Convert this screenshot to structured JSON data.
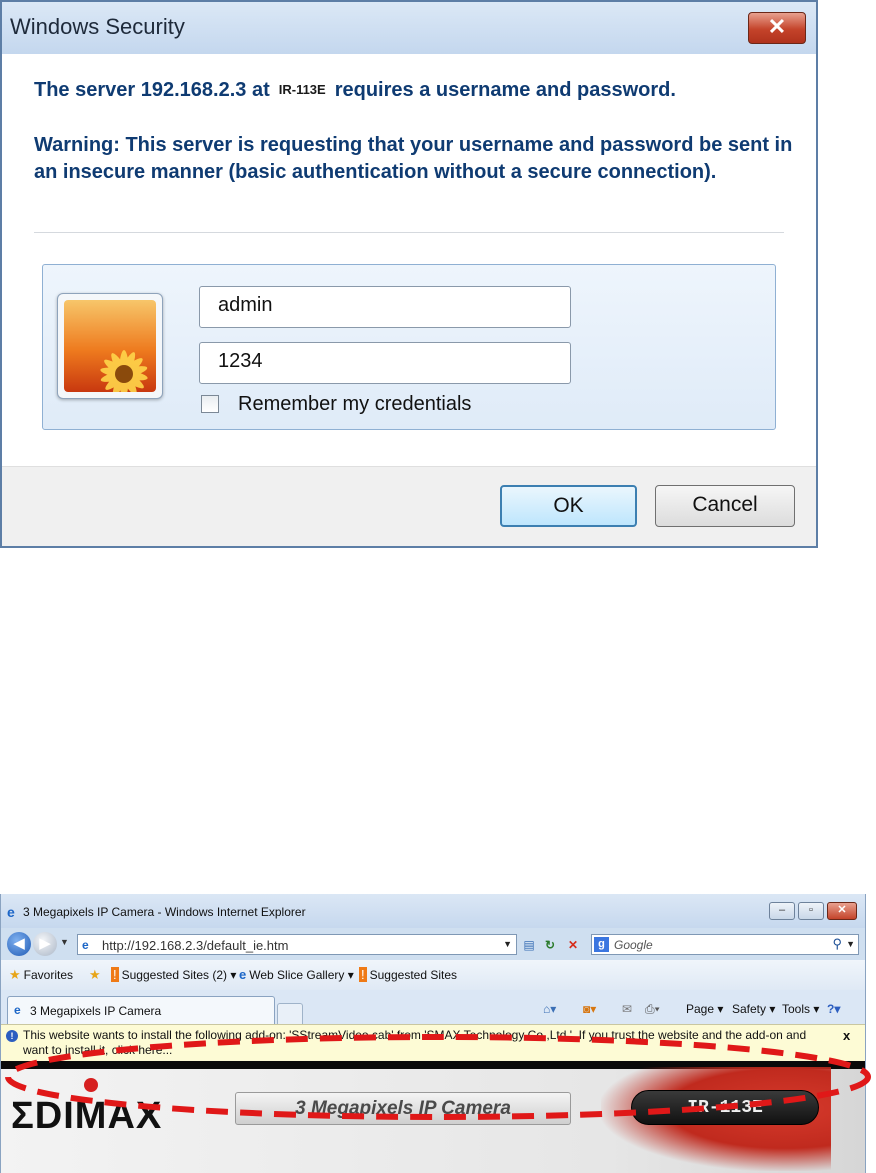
{
  "dialog": {
    "title": "Windows Security",
    "close_glyph": "✕",
    "server_prefix": "The server 192.168.2.3 at",
    "realm": "IR-113E",
    "server_suffix": "requires a username and password.",
    "warning": "Warning: This server is requesting that your username and password be sent in an insecure manner (basic authentication without a secure connection).",
    "username_value": "admin",
    "password_value": "1234",
    "remember_label": "Remember my credentials",
    "ok_label": "OK",
    "cancel_label": "Cancel"
  },
  "browser": {
    "window_title": "3 Megapixels IP Camera - Windows Internet Explorer",
    "address": "http://192.168.2.3/default_ie.htm",
    "search_placeholder": "Google",
    "favorites": {
      "favorites_label": "Favorites",
      "suggested_sites_2": "Suggested Sites (2) ▾",
      "web_slice_gallery": "Web Slice Gallery ▾",
      "suggested_sites": "Suggested Sites"
    },
    "tab_label": "3 Megapixels IP Camera",
    "commands": {
      "page": "Page ▾",
      "safety": "Safety ▾",
      "tools": "Tools ▾"
    },
    "infobar_text": "This website wants to install the following add-on: 'SStreamVideo.cab' from 'SMAX Technology Co.,Ltd.'. If you trust the website and the add-on and want to install it, click here...",
    "infobar_close": "x"
  },
  "page": {
    "logo_text": "ΣDIMAX",
    "product_title": "3 Megapixels IP Camera",
    "model_label": "IR-113E"
  },
  "icons": [
    "close-icon",
    "user-tile-image",
    "back-arrow-icon",
    "forward-arrow-icon",
    "ie-page-icon",
    "compatibility-icon",
    "refresh-icon",
    "stop-icon",
    "google-icon",
    "search-icon",
    "favorites-star-icon",
    "add-favorite-icon",
    "home-icon",
    "feeds-icon",
    "mail-icon",
    "print-icon",
    "help-icon",
    "infobar-shield-icon"
  ],
  "colors": {
    "dialog_text": "#0f3b72",
    "highlight_ellipse": "#e01818",
    "infobar_bg": "#fdfbd5"
  }
}
